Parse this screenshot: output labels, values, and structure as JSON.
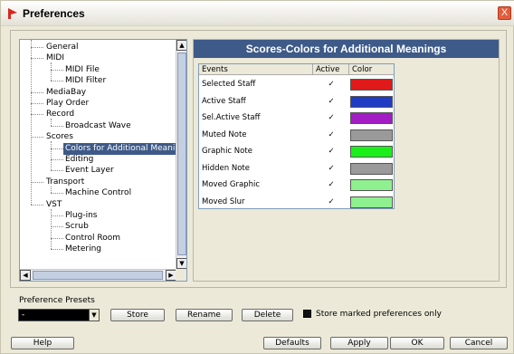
{
  "window": {
    "title": "Preferences",
    "close_glyph": "X"
  },
  "tree": {
    "items": [
      {
        "label": "General",
        "level": 1
      },
      {
        "label": "MIDI",
        "level": 1
      },
      {
        "label": "MIDI File",
        "level": 2
      },
      {
        "label": "MIDI Filter",
        "level": 2
      },
      {
        "label": "MediaBay",
        "level": 1
      },
      {
        "label": "Play Order",
        "level": 1
      },
      {
        "label": "Record",
        "level": 1
      },
      {
        "label": "Broadcast Wave",
        "level": 2
      },
      {
        "label": "Scores",
        "level": 1
      },
      {
        "label": "Colors for Additional Meanings",
        "level": 2,
        "selected": true
      },
      {
        "label": "Editing",
        "level": 2
      },
      {
        "label": "Event Layer",
        "level": 2
      },
      {
        "label": "Transport",
        "level": 1
      },
      {
        "label": "Machine Control",
        "level": 2
      },
      {
        "label": "VST",
        "level": 1
      },
      {
        "label": "Plug-ins",
        "level": 2
      },
      {
        "label": "Scrub",
        "level": 2
      },
      {
        "label": "Control Room",
        "level": 2
      },
      {
        "label": "Metering",
        "level": 2
      }
    ],
    "scroll_up": "▲",
    "scroll_down": "▼",
    "scroll_left": "◀",
    "scroll_right": "▶"
  },
  "panel": {
    "title": "Scores-Colors for Additional Meanings",
    "columns": [
      "Events",
      "Active",
      "Color"
    ],
    "rows": [
      {
        "event": "Selected Staff",
        "active": "✓",
        "color": "#e01a1a"
      },
      {
        "event": "Active Staff",
        "active": "✓",
        "color": "#1f3cc4"
      },
      {
        "event": "Sel.Active Staff",
        "active": "✓",
        "color": "#a21ec4"
      },
      {
        "event": "Muted Note",
        "active": "✓",
        "color": "#9a9a9a"
      },
      {
        "event": "Graphic Note",
        "active": "✓",
        "color": "#1aef1a"
      },
      {
        "event": "Hidden Note",
        "active": "✓",
        "color": "#9a9a9a"
      },
      {
        "event": "Moved Graphic",
        "active": "✓",
        "color": "#8ef08e"
      },
      {
        "event": "Moved Slur",
        "active": "✓",
        "color": "#8ef08e"
      }
    ]
  },
  "presets": {
    "label": "Preference Presets",
    "selected": "-",
    "arrow": "▼",
    "store": "Store",
    "rename": "Rename",
    "delete": "Delete",
    "store_marked_label": "Store marked preferences only"
  },
  "footer": {
    "help": "Help",
    "defaults": "Defaults",
    "apply": "Apply",
    "ok": "OK",
    "cancel": "Cancel"
  }
}
